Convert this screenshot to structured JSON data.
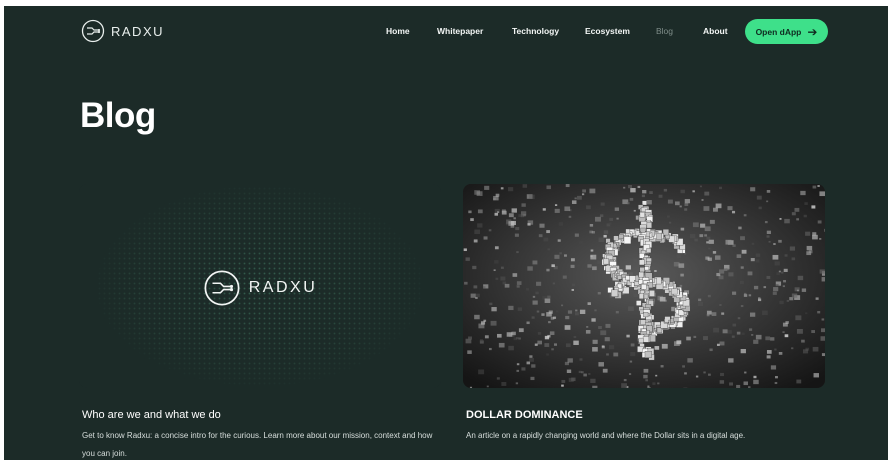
{
  "header": {
    "logo_text": "RADXU",
    "nav": [
      {
        "label": "Home",
        "active": false
      },
      {
        "label": "Whitepaper",
        "active": false
      },
      {
        "label": "Technology",
        "active": false
      },
      {
        "label": "Ecosystem",
        "active": false
      },
      {
        "label": "Blog",
        "active": true
      },
      {
        "label": "About",
        "active": false
      }
    ],
    "cta_label": "Open dApp",
    "cta_icon": "arrow-right-icon"
  },
  "page": {
    "title": "Blog"
  },
  "posts": [
    {
      "image": "radxu-logo-dotted-background",
      "image_text": "RADXU",
      "title": "Who are we and what we do",
      "description": "Get to know Radxu: a concise intro for the curious. Learn more about our mission, context and how you can join."
    },
    {
      "image": "3d-dollar-sign-cubes",
      "title": "DOLLAR DOMINANCE",
      "description": "An article on a rapidly changing world and where the Dollar sits in a digital age."
    }
  ],
  "colors": {
    "background": "#1c2b28",
    "accent": "#3ee08a",
    "text": "#ffffff",
    "nav_muted": "#7f8d89"
  }
}
